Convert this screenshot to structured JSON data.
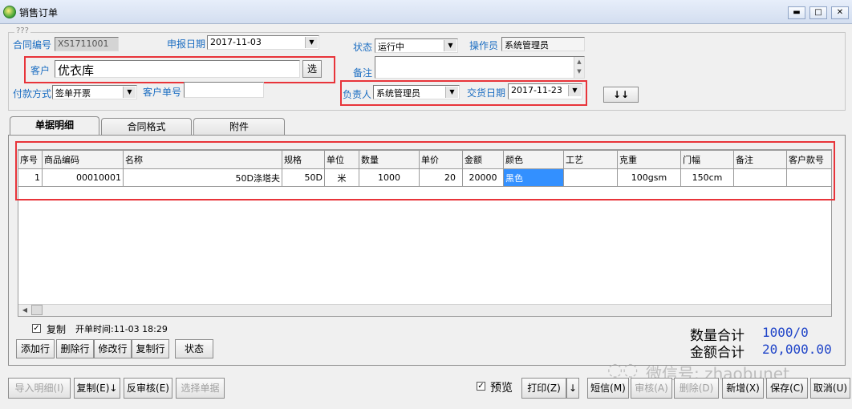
{
  "window": {
    "title": "销售订单"
  },
  "group": {
    "label": "???"
  },
  "fields": {
    "contract_no": {
      "label": "合同编号",
      "value": "XS1711001"
    },
    "report_date": {
      "label": "申报日期",
      "value": "2017-11-03"
    },
    "customer": {
      "label": "客户",
      "value": "优衣库",
      "select_label": "选"
    },
    "payment": {
      "label": "付款方式",
      "value": "签单开票"
    },
    "customer_order": {
      "label": "客户单号",
      "value": ""
    },
    "status": {
      "label": "状态",
      "value": "运行中"
    },
    "operator": {
      "label": "操作员",
      "value": "系统管理员"
    },
    "remark": {
      "label": "备注",
      "value": ""
    },
    "owner": {
      "label": "负责人",
      "value": "系统管理员"
    },
    "delivery_date": {
      "label": "交货日期",
      "value": "2017-11-23"
    },
    "arrow_button": "↓↓"
  },
  "tabs": [
    "单据明细",
    "合同格式",
    "附件"
  ],
  "table": {
    "columns": [
      "序号",
      "商品编码",
      "名称",
      "规格",
      "单位",
      "数量",
      "单价",
      "金额",
      "颜色",
      "工艺",
      "克重",
      "门幅",
      "备注",
      "客户款号"
    ],
    "rows": [
      [
        "1",
        "00010001",
        "50D涤塔夫",
        "50D",
        "米",
        "1000",
        "20",
        "20000",
        "黑色",
        "",
        "100gsm",
        "150cm",
        "",
        ""
      ]
    ]
  },
  "copy_checkbox": {
    "label": "复制",
    "checked": true
  },
  "open_time": "开单时间:11-03 18:29",
  "row_buttons": [
    "添加行",
    "删除行",
    "修改行",
    "复制行"
  ],
  "status_button": "状态",
  "totals": {
    "qty_label": "数量合计",
    "qty_value": "1000/0",
    "amount_label": "金额合计",
    "amount_value": "20,000.00"
  },
  "watermark": "微信号: zhaobunet",
  "footer": {
    "import_detail": "导入明细(I)",
    "copy": "复制(E)↓",
    "unapprove": "反审核(E)",
    "select_doc": "选择单据",
    "preview": "预览",
    "print": "打印(Z)",
    "print_arrow": "↓",
    "sms": "短信(M)",
    "approve": "审核(A)",
    "delete": "删除(D)",
    "new": "新增(X)",
    "save": "保存(C)",
    "cancel": "取消(U)"
  }
}
